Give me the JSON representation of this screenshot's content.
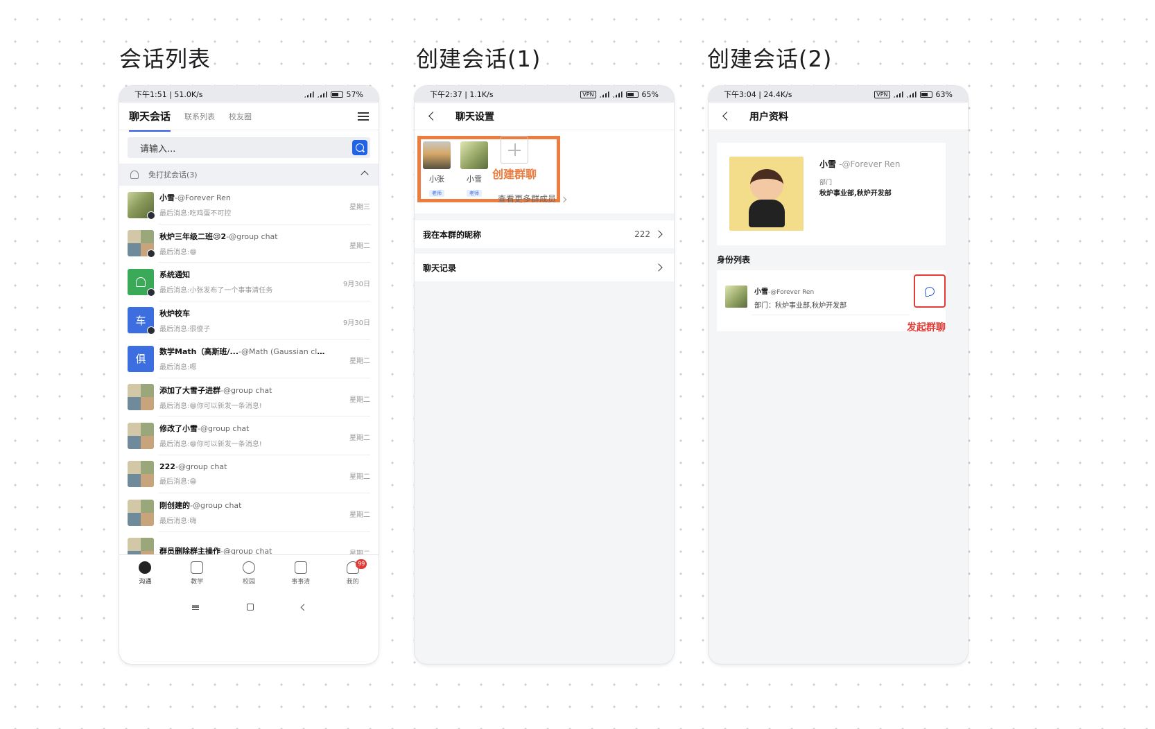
{
  "titles": {
    "p1": "会话列表",
    "p2": "创建会话(1)",
    "p3": "创建会话(2)"
  },
  "p1": {
    "status": {
      "left": "下午1:51 | 51.0K/s",
      "battery": "57%"
    },
    "tabs": {
      "chat": "聊天会话",
      "contacts": "联系列表",
      "alumni": "校友圈"
    },
    "search_placeholder": "请输入...",
    "mute_section": "免打扰会话(3)",
    "chats": [
      {
        "name": "小雪",
        "sub": "-@Forever Ren",
        "msg": "最后消息:吃鸡蛋不可控",
        "time": "星期三"
      },
      {
        "name": "秋炉三年级二班😢2",
        "sub": "-@group chat",
        "msg": "最后消息:😁",
        "time": "星期二"
      },
      {
        "name": "系统通知",
        "sub": "",
        "msg": "最后消息:小张发布了一个事事清任务",
        "time": "9月30日"
      },
      {
        "name": "秋炉校车",
        "sub": "",
        "msg": "最后消息:很傻子",
        "time": "9月30日",
        "avatar_char": "车"
      },
      {
        "name": "数学Math（高斯班/...",
        "sub": "-@Math (Gaussian class...",
        "msg": "最后消息:嗯",
        "time": "星期二",
        "avatar_char": "俱"
      },
      {
        "name": "添加了大雪子进群",
        "sub": "-@group chat",
        "msg": "最后消息:😁你可以新发一条消息!",
        "time": "星期二"
      },
      {
        "name": "修改了小雪",
        "sub": "-@group chat",
        "msg": "最后消息:😁你可以新发一条消息!",
        "time": "星期二"
      },
      {
        "name": "222",
        "sub": "-@group chat",
        "msg": "最后消息:😁",
        "time": "星期二"
      },
      {
        "name": "刚创建的",
        "sub": "-@group chat",
        "msg": "最后消息:嗨",
        "time": "星期二"
      },
      {
        "name": "群员删除群主操作",
        "sub": "-@group chat",
        "msg": "",
        "time": "星期二"
      }
    ],
    "tabbar": [
      {
        "label": "沟通"
      },
      {
        "label": "教学"
      },
      {
        "label": "校园"
      },
      {
        "label": "事事清"
      },
      {
        "label": "我的",
        "badge": "99"
      }
    ]
  },
  "p2": {
    "status": {
      "left": "下午2:37 | 1.1K/s",
      "battery": "65%"
    },
    "title": "聊天设置",
    "members": [
      {
        "name": "小张",
        "tag": "老师"
      },
      {
        "name": "小雪",
        "tag": "老师"
      }
    ],
    "create_group": "创建群聊",
    "more_members": "查看更多群成员",
    "nickname_label": "我在本群的昵称",
    "nickname_value": "222",
    "history_label": "聊天记录"
  },
  "p3": {
    "status": {
      "left": "下午3:04 | 24.4K/s",
      "battery": "63%"
    },
    "title": "用户资料",
    "name": "小雪",
    "name_sub": "-@Forever Ren",
    "dept_label": "部门",
    "dept": "秋炉事业部,秋炉开发部",
    "id_list_title": "身份列表",
    "id_name": "小雪",
    "id_sub": "-@Forever Ren",
    "id_dept": "部门：秋炉事业部,秋炉开发部",
    "start_chat": "发起群聊"
  },
  "colors": {
    "accent_blue": "#2162e6",
    "highlight_orange": "#ec7c3f",
    "alert_red": "#e53935"
  }
}
